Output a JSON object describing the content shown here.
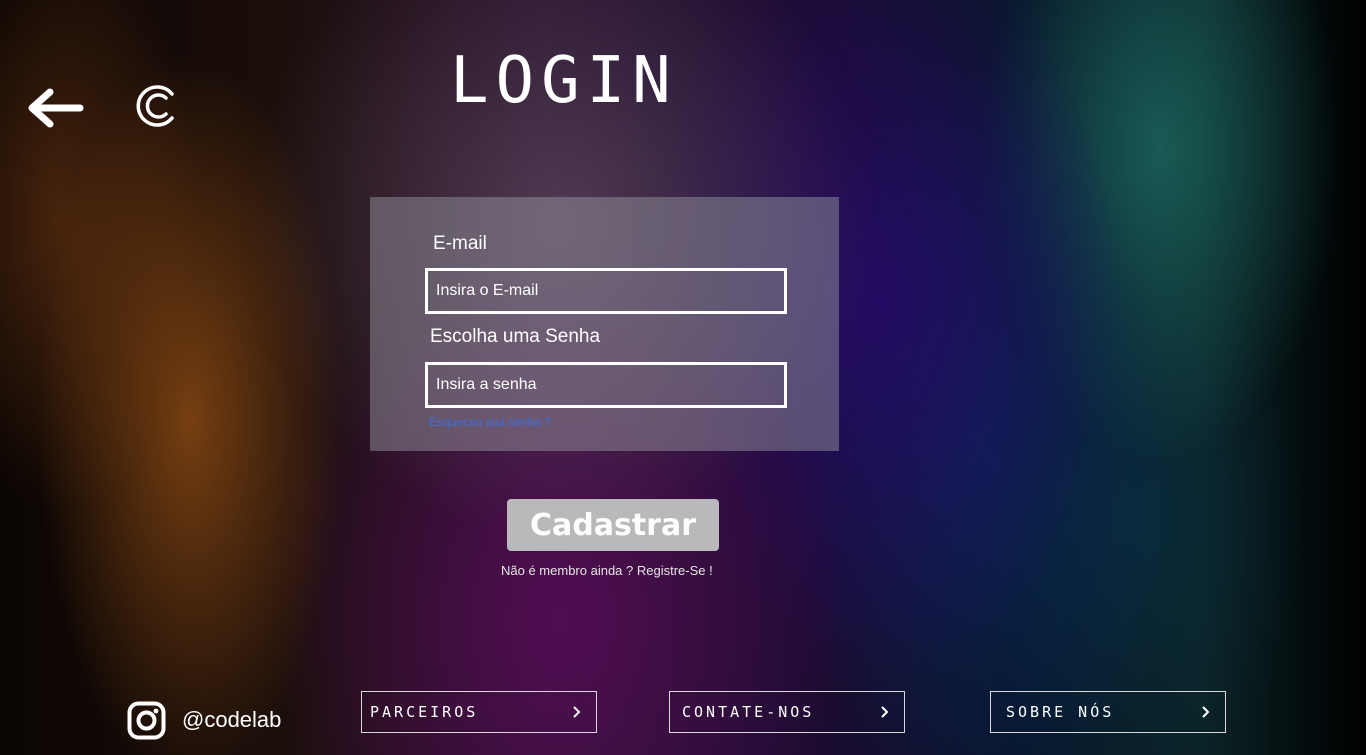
{
  "page": {
    "title": "LOGIN"
  },
  "nav": {
    "back_icon": "arrow-left-icon",
    "logo_icon": "codelab-c-logo"
  },
  "form": {
    "email_label": "E-mail",
    "email_placeholder": "Insira o E-mail",
    "password_label": "Escolha uma Senha",
    "password_placeholder": "Insira a senha",
    "forgot_link": "Esqueceu sua senha  ?",
    "submit_label": "Cadastrar",
    "register_text": "Não é membro ainda  ? Registre-Se !"
  },
  "footer": {
    "instagram_icon": "instagram-icon",
    "handle": "@codelab",
    "buttons": [
      {
        "label": "PARCEIROS",
        "icon": "chevron-right-icon"
      },
      {
        "label": "CONTATE-NOS",
        "icon": "chevron-right-icon"
      },
      {
        "label": "SOBRE NÓS",
        "icon": "chevron-right-icon"
      }
    ]
  },
  "colors": {
    "card_bg": "#8f8f99",
    "submit_bg": "#b9b9bb",
    "link": "#3f6fd8",
    "text": "#ffffff"
  }
}
